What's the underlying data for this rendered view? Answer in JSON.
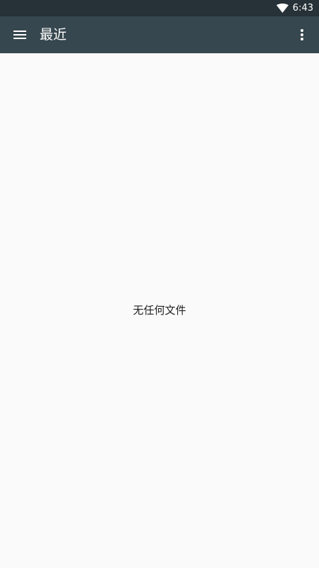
{
  "status_bar": {
    "time": "6:43",
    "icons": [
      "wifi-icon"
    ]
  },
  "app_bar": {
    "menu_icon": "menu-icon",
    "title": "最近",
    "overflow_icon": "more-vert-icon"
  },
  "content": {
    "empty_message": "无任何文件"
  },
  "colors": {
    "status_bar": "#263238",
    "app_bar": "#37474f",
    "background": "#fafafa",
    "text": "#212121"
  }
}
